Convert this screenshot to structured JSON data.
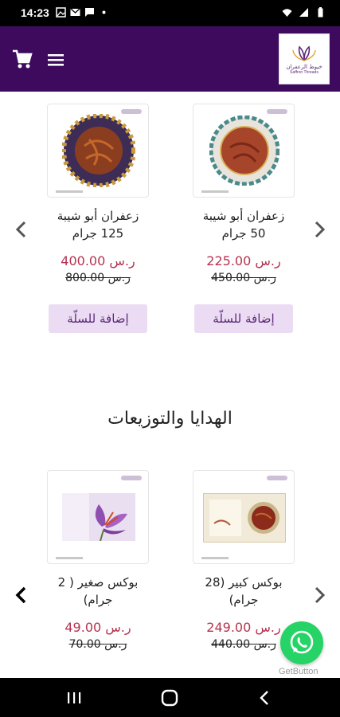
{
  "status_bar": {
    "time": "14:23"
  },
  "header": {
    "logo_text_ar": "خيوط الزعفران",
    "logo_text_en": "Saffron Threads"
  },
  "row1": [
    {
      "name_line1": "زعفران أبو شيبة",
      "name_line2": "50 جرام",
      "price": "225.00 ر.س",
      "old_price": "450.00 ر.س",
      "add_label": "إضافة للسلّة"
    },
    {
      "name_line1": "زعفران أبو شيبة",
      "name_line2": "125 جرام",
      "price": "400.00 ر.س",
      "old_price": "800.00 ر.س",
      "add_label": "إضافة للسلّة"
    }
  ],
  "gifts_section": {
    "title": "الهدايا والتوزيعات"
  },
  "row2": [
    {
      "name_line1": "بوكس كبير (28",
      "name_line2": "جرام)",
      "price": "249.00 ر.س",
      "old_price": "440.00 ر.س"
    },
    {
      "name_line1": "بوكس صغير ( 2",
      "name_line2": "جرام)",
      "price": "49.00 ر.س",
      "old_price": "70.00 ر.س"
    }
  ],
  "whatsapp": {
    "label": "GetButton"
  },
  "colors": {
    "header": "#3e0a5e",
    "price": "#b5334f",
    "add_button_bg": "#ecdcf3",
    "whatsapp": "#25d366"
  }
}
